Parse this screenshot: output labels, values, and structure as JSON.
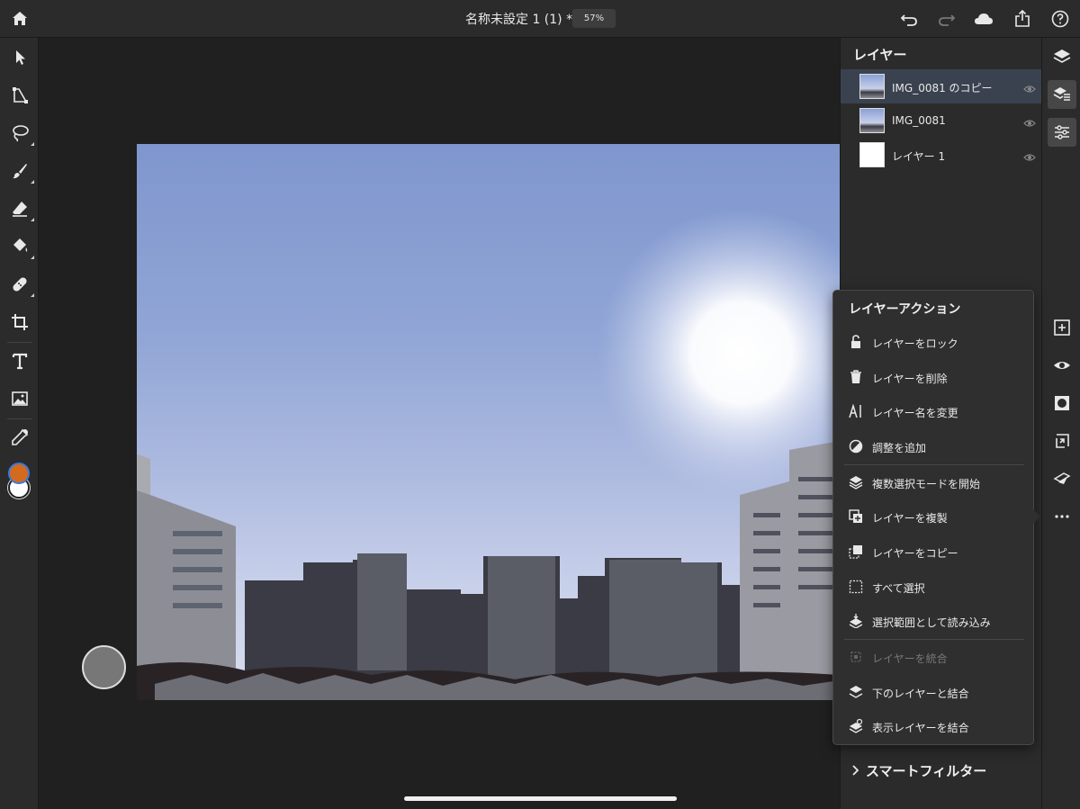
{
  "header": {
    "doc_title": "名称未設定 1 (1) *",
    "zoom": "57%"
  },
  "layers": {
    "title": "レイヤー",
    "items": [
      {
        "name": "IMG_0081 のコピー",
        "selected": true
      },
      {
        "name": "IMG_0081",
        "selected": false
      },
      {
        "name": "レイヤー 1",
        "selected": false
      }
    ],
    "smart_filter": "スマートフィルター"
  },
  "menu": {
    "title": "レイヤーアクション",
    "items": [
      {
        "label": "レイヤーをロック",
        "icon": "unlock-icon",
        "enabled": true
      },
      {
        "label": "レイヤーを削除",
        "icon": "trash-icon",
        "enabled": true
      },
      {
        "label": "レイヤー名を変更",
        "icon": "rename-icon",
        "enabled": true
      },
      {
        "label": "調整を追加",
        "icon": "adjustment-icon",
        "enabled": true
      },
      {
        "label": "複数選択モードを開始",
        "icon": "layers-stack-icon",
        "enabled": true
      },
      {
        "label": "レイヤーを複製",
        "icon": "duplicate-icon",
        "enabled": true
      },
      {
        "label": "レイヤーをコピー",
        "icon": "copy-icon",
        "enabled": true
      },
      {
        "label": "すべて選択",
        "icon": "select-all-icon",
        "enabled": true
      },
      {
        "label": "選択範囲として読み込み",
        "icon": "load-selection-icon",
        "enabled": true
      },
      {
        "label": "レイヤーを統合",
        "icon": "flatten-icon",
        "enabled": false
      },
      {
        "label": "下のレイヤーと結合",
        "icon": "merge-down-icon",
        "enabled": true
      },
      {
        "label": "表示レイヤーを結合",
        "icon": "merge-visible-icon",
        "enabled": true
      }
    ]
  },
  "colors": {
    "foreground": "#d46a1e",
    "background": "#ffffff",
    "accent": "#3b7ad9"
  }
}
